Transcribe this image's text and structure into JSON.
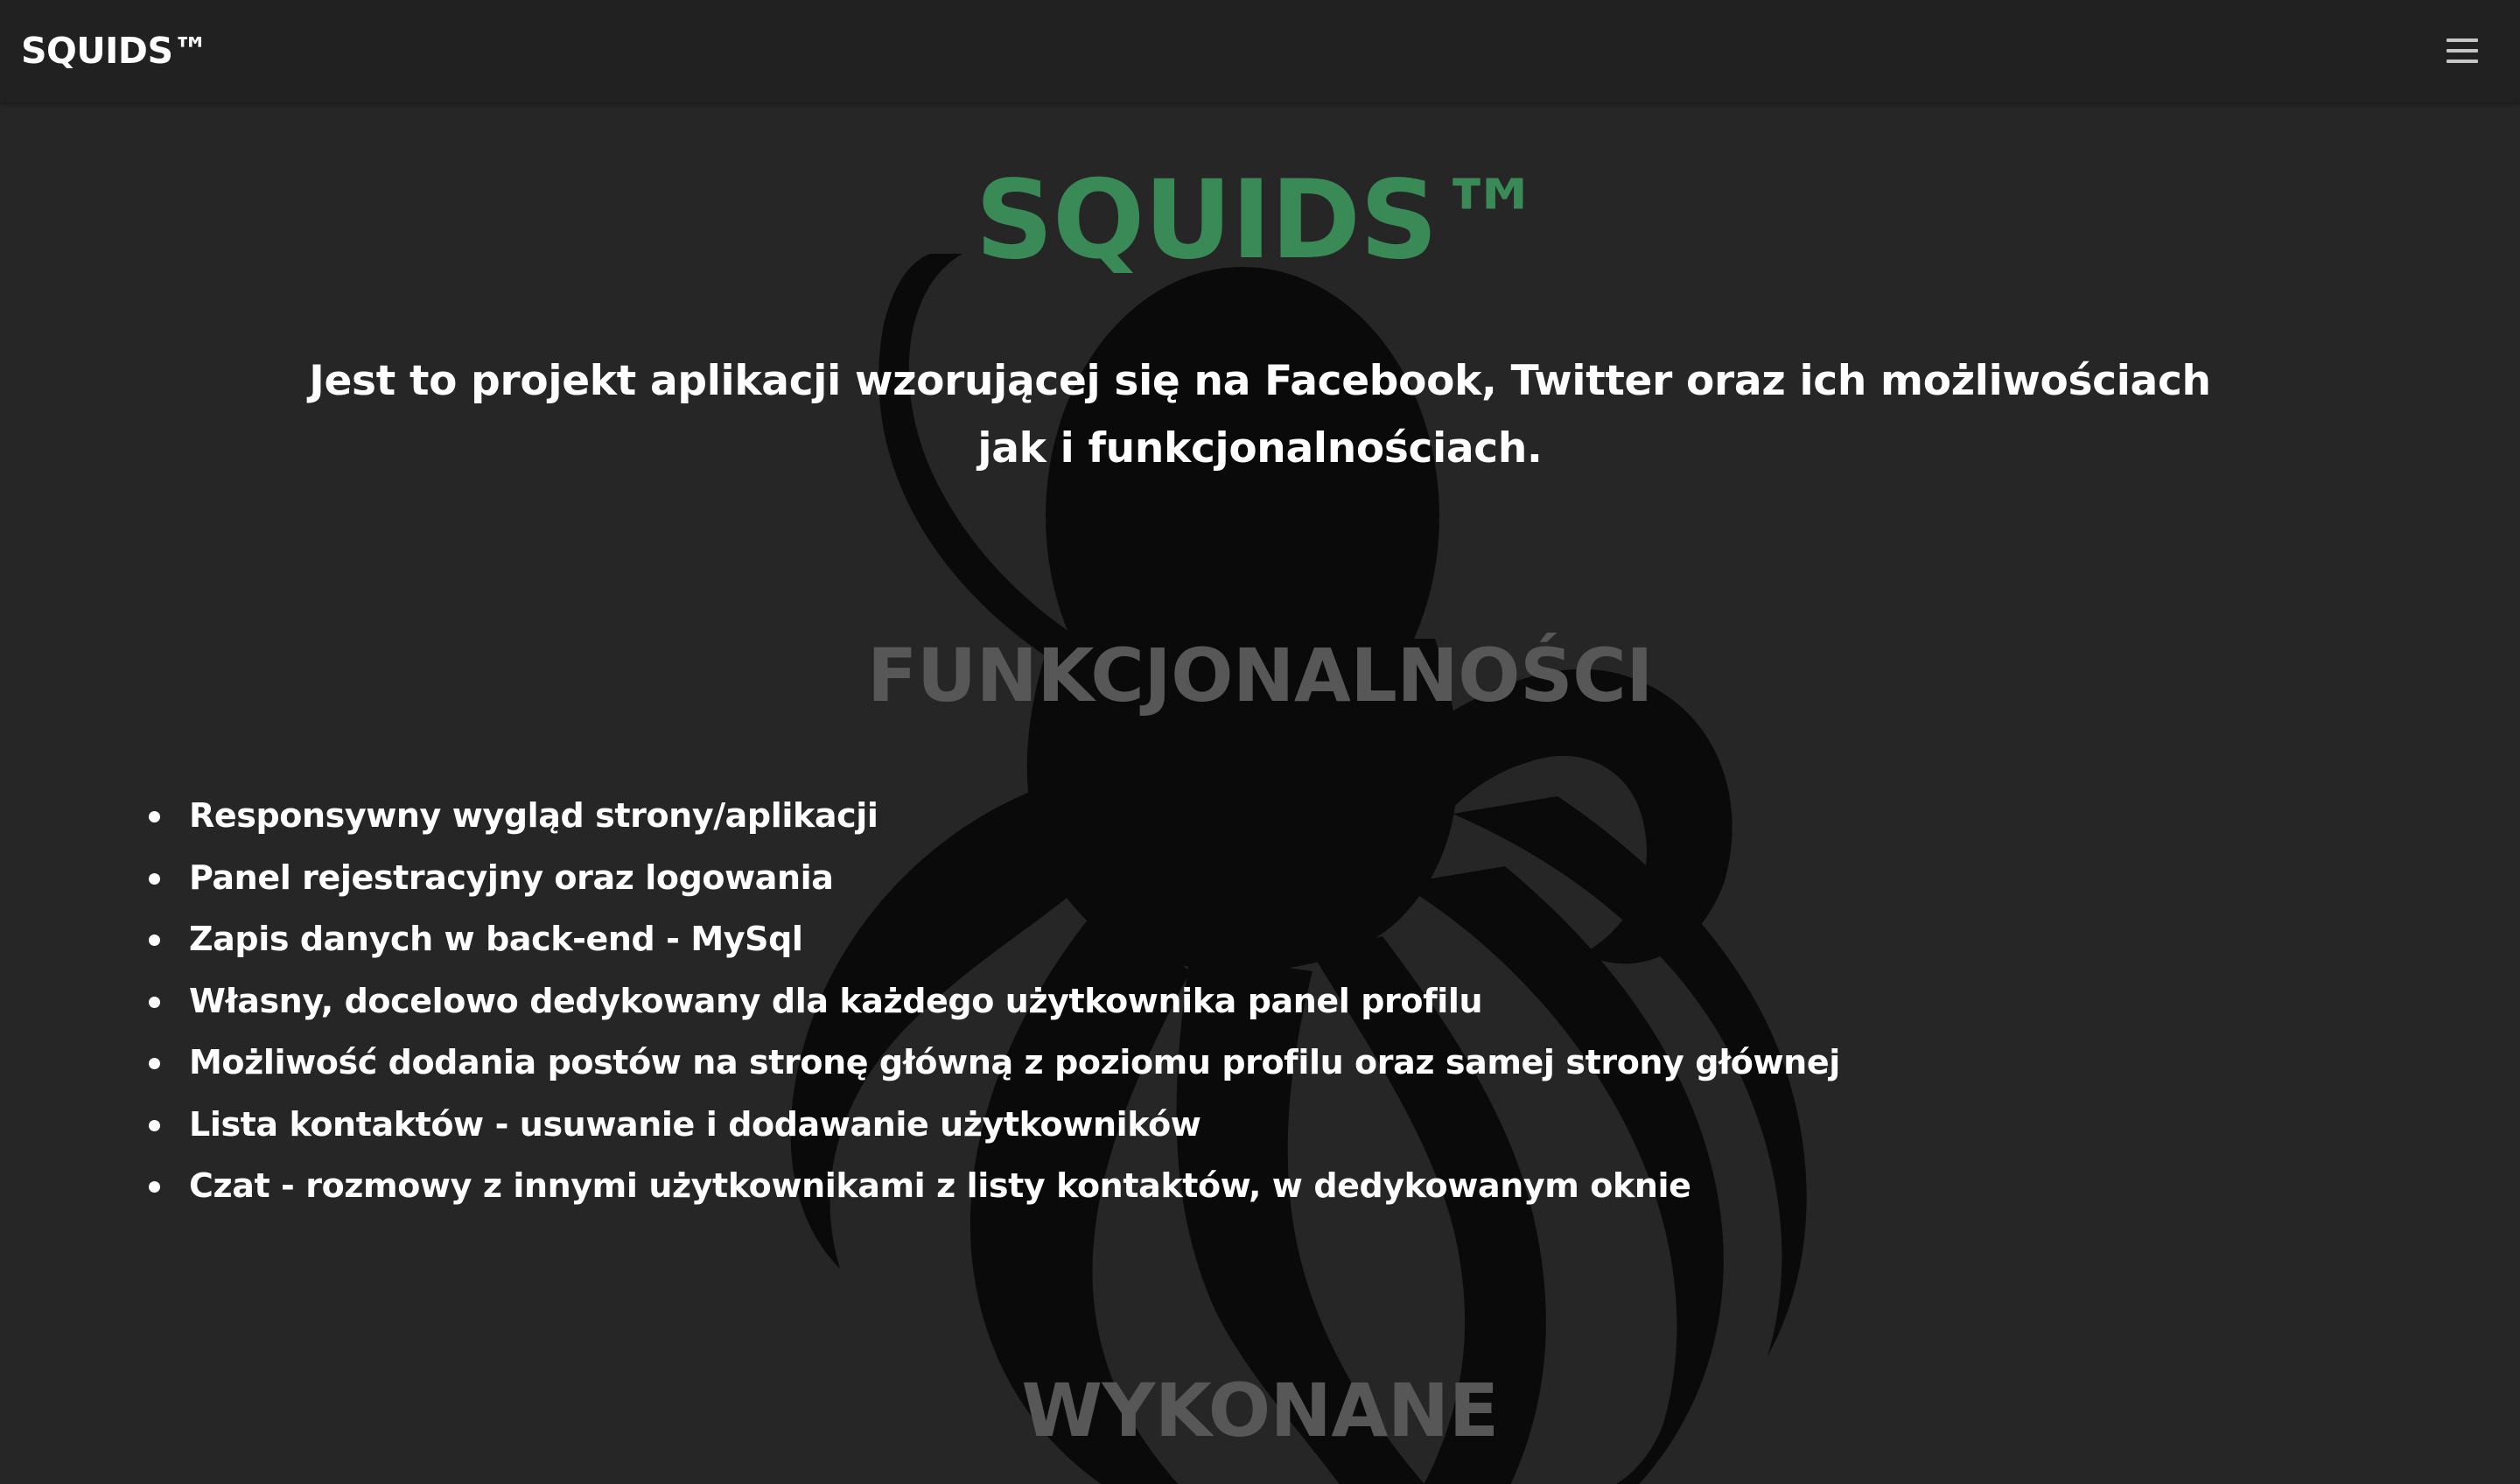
{
  "navbar": {
    "brand": "SQUIDS™",
    "menu_icon": "hamburger-menu-icon"
  },
  "hero": {
    "title": "SQUIDS™",
    "description": "Jest to projekt aplikacji wzorującej się na Facebook, Twitter oraz ich możliwościach jak i funkcjonalnościach."
  },
  "features": {
    "title": "FUNKCJONALNOŚCI",
    "items": [
      "Responsywny wygląd strony/aplikacji",
      "Panel rejestracyjny oraz logowania",
      "Zapis danych w back-end - MySql",
      "Własny, docelowo dedykowany dla każdego użytkownika panel profilu",
      "Możliwość dodania postów na stronę główną z poziomu profilu oraz samej strony głównej",
      "Lista kontaktów - usuwanie i dodawanie użytkowników",
      "Czat - rozmowy z innymi użytkownikami z listy kontaktów, w dedykowanym oknie"
    ]
  },
  "done_section": {
    "title": "WYKONANE"
  },
  "background": {
    "icon": "octopus-silhouette-icon"
  },
  "colors": {
    "page_background": "#262626",
    "navbar_background": "#212121",
    "accent_green": "#3a8a57",
    "section_title_gray": "#575757",
    "text": "#ffffff",
    "octopus": "#000000"
  }
}
